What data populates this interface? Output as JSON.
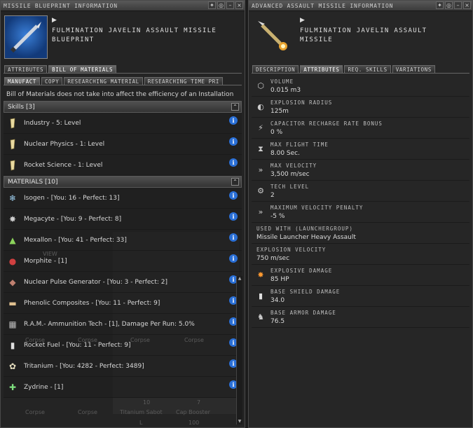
{
  "left": {
    "title": "MISSILE BLUEPRINT INFORMATION",
    "item_name_line1": "FULMINATION JAVELIN ASSAULT MISSILE",
    "item_name_line2": "BLUEPRINT",
    "main_tabs": [
      "ATTRIBUTES",
      "BILL OF MATERIALS"
    ],
    "sub_tabs": [
      "MANUFACT",
      "COPY",
      "RESEARCHING MATERIAL",
      "RESEARCHING TIME PRI"
    ],
    "note": "Bill of Materials does not take into affect the efficiency of an Installation",
    "skills_header": "Skills [3]",
    "skills": [
      {
        "label": "Industry - 5: Level"
      },
      {
        "label": "Nuclear Physics - 1: Level"
      },
      {
        "label": "Rocket Science - 1: Level"
      }
    ],
    "materials_header": "MATERIALS [10]",
    "materials": [
      {
        "label": "Isogen - [You: 16 - Perfect: 13]"
      },
      {
        "label": "Megacyte - [You: 9 - Perfect: 8]"
      },
      {
        "label": "Mexallon - [You: 41 - Perfect: 33]"
      },
      {
        "label": "Morphite - [1]"
      },
      {
        "label": "Nuclear Pulse Generator - [You: 3 - Perfect: 2]"
      },
      {
        "label": "Phenolic Composites - [You: 11 - Perfect: 9]"
      },
      {
        "label": "R.A.M.- Ammunition Tech - [1], Damage Per Run: 5.0%"
      },
      {
        "label": "Rocket Fuel - [You: 11 - Perfect: 9]"
      },
      {
        "label": "Tritanium - [You: 4282 - Perfect: 3489]"
      },
      {
        "label": "Zydrine - [1]"
      }
    ],
    "background_labels": [
      "Corpse",
      "Corpse",
      "Corpse",
      "Corpse",
      "Corpse",
      "Corpse",
      "Titanium Sabot",
      "Cap Booster",
      "10",
      "7",
      "L",
      "100",
      "VIEW"
    ]
  },
  "right": {
    "title": "ADVANCED ASSAULT MISSILE INFORMATION",
    "item_name_line1": "FULMINATION JAVELIN ASSAULT",
    "item_name_line2": "MISSILE",
    "tabs": [
      "DESCRIPTION",
      "ATTRIBUTES",
      "REQ. SKILLS",
      "VARIATIONS"
    ],
    "attributes": [
      {
        "name": "VOLUME",
        "value": "0.015 m3",
        "icon": "cube-icon"
      },
      {
        "name": "EXPLOSION RADIUS",
        "value": "125m",
        "icon": "radius-icon"
      },
      {
        "name": "CAPACITOR RECHARGE RATE BONUS",
        "value": "0 %",
        "icon": "capacitor-icon"
      },
      {
        "name": "MAX FLIGHT TIME",
        "value": "8.00 Sec.",
        "icon": "hourglass-icon"
      },
      {
        "name": "MAX VELOCITY",
        "value": "3,500 m/sec",
        "icon": "velocity-icon"
      },
      {
        "name": "TECH LEVEL",
        "value": "2",
        "icon": "tech-level-icon"
      },
      {
        "name": "MAXIMUM VELOCITY PENALTY",
        "value": "-5 %",
        "icon": "velocity-penalty-icon"
      },
      {
        "name": "USED WITH (LAUNCHERGROUP)",
        "value": "Missile Launcher Heavy Assault",
        "icon": ""
      },
      {
        "name": "EXPLOSION VELOCITY",
        "value": "750 m/sec",
        "icon": ""
      },
      {
        "name": "EXPLOSIVE DAMAGE",
        "value": "85 HP",
        "icon": "explosive-icon"
      },
      {
        "name": "BASE SHIELD DAMAGE",
        "value": "34.0",
        "icon": "shield-icon"
      },
      {
        "name": "BASE ARMOR DAMAGE",
        "value": "76.5",
        "icon": "armor-icon"
      }
    ]
  },
  "colors": {
    "info_blue": "#2a6fd6",
    "panel_bg": "#242424",
    "header_bg": "#454545"
  }
}
